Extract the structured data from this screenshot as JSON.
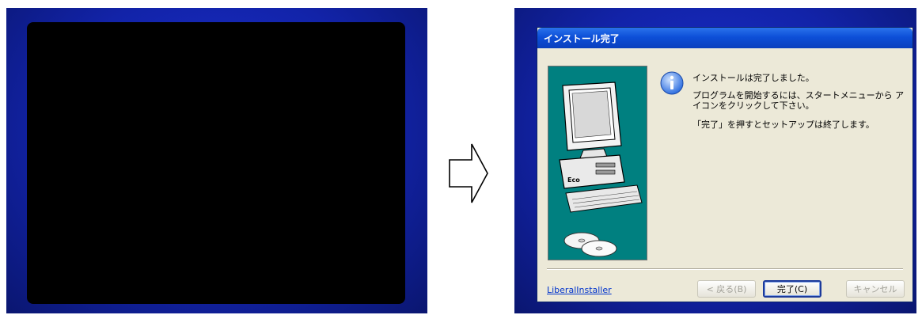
{
  "dialog": {
    "title": "インストール完了",
    "messages": [
      "インストールは完了しました。",
      "プログラムを開始するには、スタートメニューから アイコンをクリックして下さい。",
      "「完了」を押すとセットアップは終了します。"
    ],
    "brand_link": "LiberalInstaller",
    "buttons": {
      "back": "< 戻る(B)",
      "finish": "完了(C)",
      "cancel": "キャンセル"
    }
  },
  "colors": {
    "desktop_blue": "#1223a8",
    "title_bar": "#0d4fd8",
    "side_panel": "#008080",
    "dialog_bg": "#ece9d8"
  },
  "icons": [
    "arrow-right-icon",
    "info-icon",
    "computer-illustration",
    "cd-disc-icon"
  ]
}
